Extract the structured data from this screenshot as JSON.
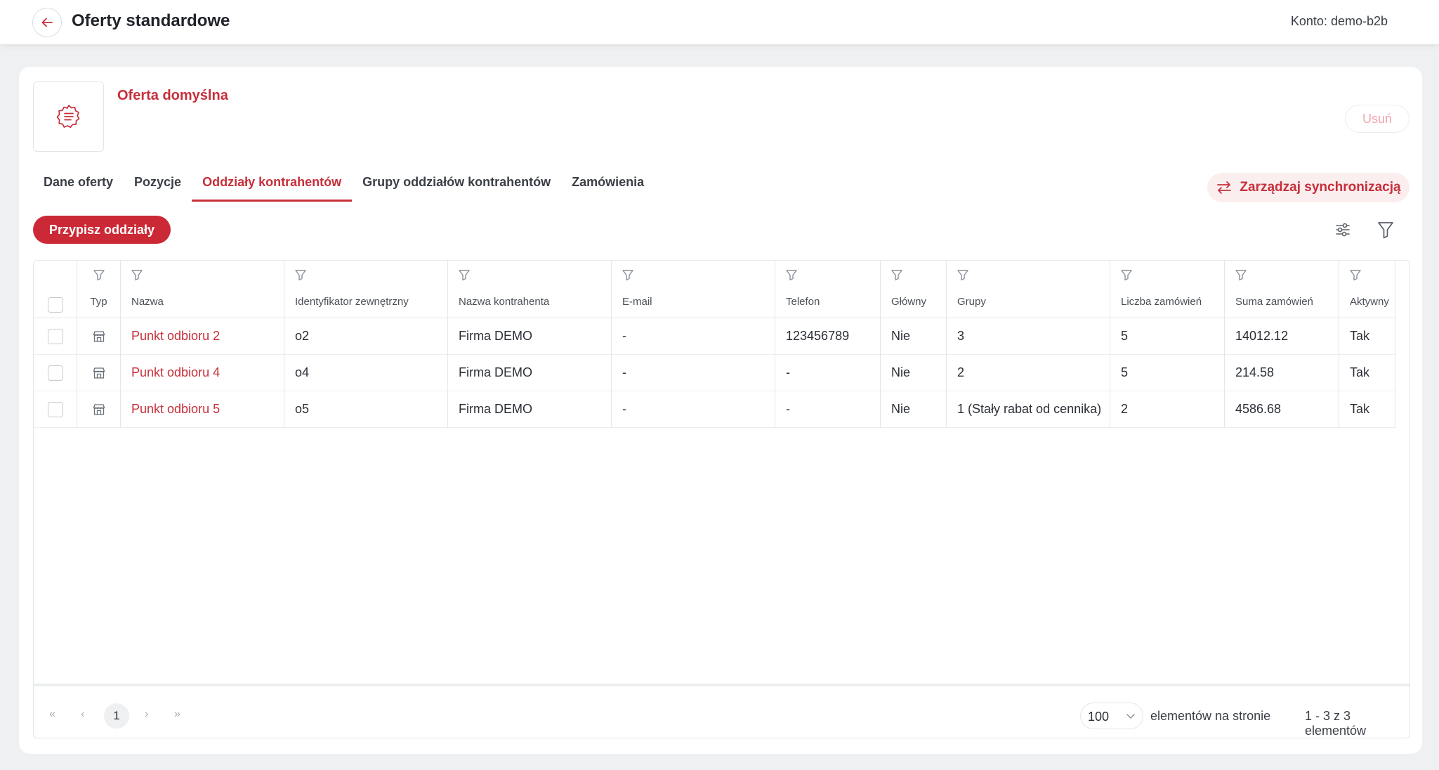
{
  "header": {
    "title": "Oferty standardowe",
    "account_label": "Konto: demo-b2b"
  },
  "offer": {
    "name": "Oferta domyślna",
    "delete_label": "Usuń"
  },
  "tabs": [
    {
      "label": "Dane oferty",
      "active": false
    },
    {
      "label": "Pozycje",
      "active": false
    },
    {
      "label": "Oddziały kontrahentów",
      "active": true
    },
    {
      "label": "Grupy oddziałów kontrahentów",
      "active": false
    },
    {
      "label": "Zamówienia",
      "active": false
    }
  ],
  "sync_label": "Zarządzaj synchronizacją",
  "assign_label": "Przypisz oddziały",
  "columns": [
    {
      "label": "Typ"
    },
    {
      "label": "Nazwa"
    },
    {
      "label": "Identyfikator zewnętrzny"
    },
    {
      "label": "Nazwa kontrahenta"
    },
    {
      "label": "E-mail"
    },
    {
      "label": "Telefon"
    },
    {
      "label": "Główny"
    },
    {
      "label": "Grupy"
    },
    {
      "label": "Liczba zamówień"
    },
    {
      "label": "Suma zamówień"
    },
    {
      "label": "Aktywny"
    }
  ],
  "rows": [
    {
      "type_icon": "store-icon",
      "name": "Punkt odbioru 2",
      "external_id": "o2",
      "contractor": "Firma DEMO",
      "email": "-",
      "phone": "123456789",
      "main": "Nie",
      "groups": "3",
      "order_count": "5",
      "order_sum": "14012.12",
      "active": "Tak"
    },
    {
      "type_icon": "store-icon",
      "name": "Punkt odbioru 4",
      "external_id": "o4",
      "contractor": "Firma DEMO",
      "email": "-",
      "phone": "-",
      "main": "Nie",
      "groups": "2",
      "order_count": "5",
      "order_sum": "214.58",
      "active": "Tak"
    },
    {
      "type_icon": "store-icon",
      "name": "Punkt odbioru 5",
      "external_id": "o5",
      "contractor": "Firma DEMO",
      "email": "-",
      "phone": "-",
      "main": "Nie",
      "groups": "1 (Stały rabat od cennika)",
      "order_count": "2",
      "order_sum": "4586.68",
      "active": "Tak"
    }
  ],
  "pagination": {
    "current_page": "1",
    "page_size": "100",
    "per_page_label": "elementów na stronie",
    "range_label": "1 - 3 z 3 elementów"
  },
  "colors": {
    "accent": "#c62f3a",
    "primary_button": "#cc2936",
    "background": "#eef0f2"
  }
}
